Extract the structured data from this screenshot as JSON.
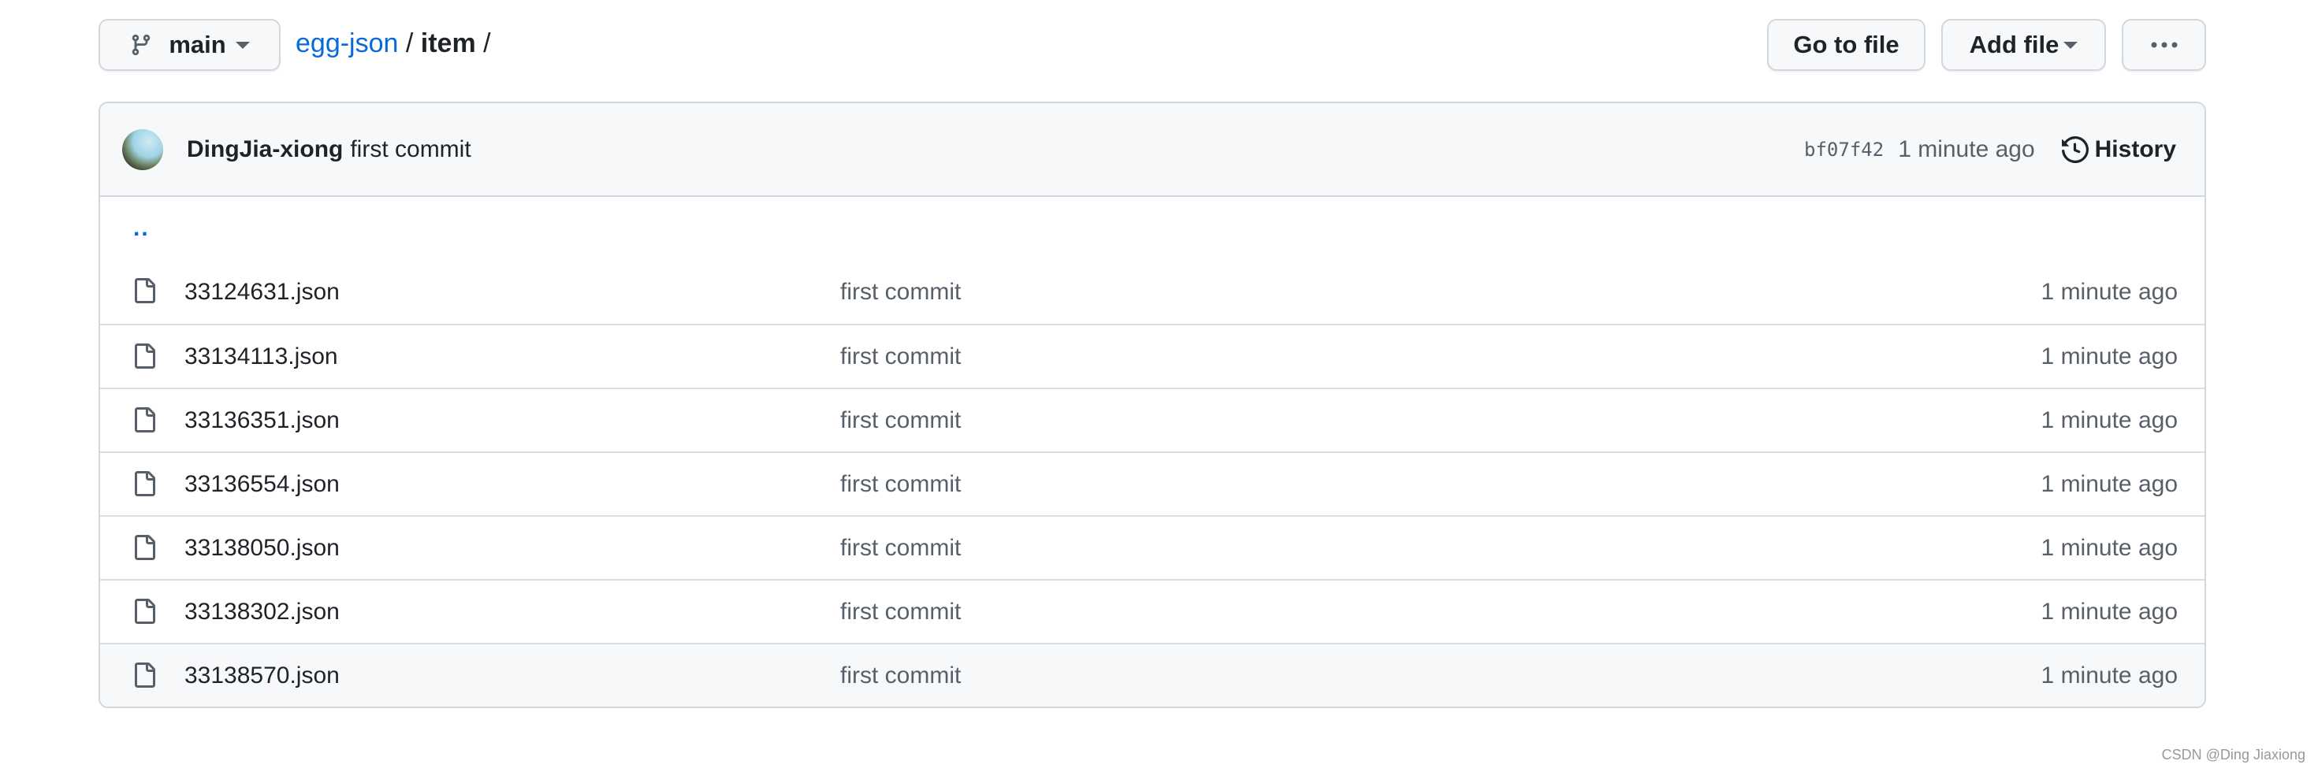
{
  "toolbar": {
    "branch": "main",
    "go_to_file": "Go to file",
    "add_file": "Add file",
    "more": "..."
  },
  "breadcrumb": {
    "repo": "egg-json",
    "sep1": "/",
    "folder": "item",
    "sep2": "/"
  },
  "commit": {
    "author": "DingJia-xiong",
    "message": "first commit",
    "sha": "bf07f42",
    "time": "1 minute ago",
    "history": "History"
  },
  "parent_dir": "..",
  "files": [
    {
      "name": "33124631.json",
      "message": "first commit",
      "time": "1 minute ago"
    },
    {
      "name": "33134113.json",
      "message": "first commit",
      "time": "1 minute ago"
    },
    {
      "name": "33136351.json",
      "message": "first commit",
      "time": "1 minute ago"
    },
    {
      "name": "33136554.json",
      "message": "first commit",
      "time": "1 minute ago"
    },
    {
      "name": "33138050.json",
      "message": "first commit",
      "time": "1 minute ago"
    },
    {
      "name": "33138302.json",
      "message": "first commit",
      "time": "1 minute ago"
    },
    {
      "name": "33138570.json",
      "message": "first commit",
      "time": "1 minute ago"
    }
  ],
  "watermark": "CSDN @Ding Jiaxiong",
  "colors": {
    "link": "#0969da",
    "border": "#d0d7de",
    "header_bg": "#f6f8fa"
  }
}
